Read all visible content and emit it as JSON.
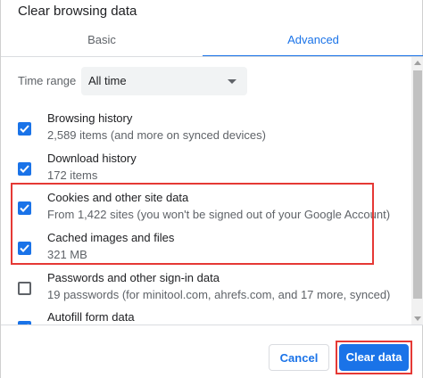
{
  "dialog": {
    "title": "Clear browsing data"
  },
  "tabs": [
    {
      "label": "Basic",
      "active": false
    },
    {
      "label": "Advanced",
      "active": true
    }
  ],
  "time_range": {
    "label": "Time range",
    "value": "All time"
  },
  "items": [
    {
      "label": "Browsing history",
      "description": "2,589 items (and more on synced devices)",
      "checked": true
    },
    {
      "label": "Download history",
      "description": "172 items",
      "checked": true
    },
    {
      "label": "Cookies and other site data",
      "description": "From 1,422 sites (you won't be signed out of your Google Account)",
      "checked": true
    },
    {
      "label": "Cached images and files",
      "description": "321 MB",
      "checked": true
    },
    {
      "label": "Passwords and other sign-in data",
      "description": "19 passwords (for minitool.com, ahrefs.com, and 17 more, synced)",
      "checked": false
    },
    {
      "label": "Autofill form data",
      "description": "",
      "checked": true
    }
  ],
  "buttons": {
    "cancel": "Cancel",
    "clear": "Clear data"
  },
  "colors": {
    "accent": "#1a73e8",
    "highlight": "#e53935"
  }
}
